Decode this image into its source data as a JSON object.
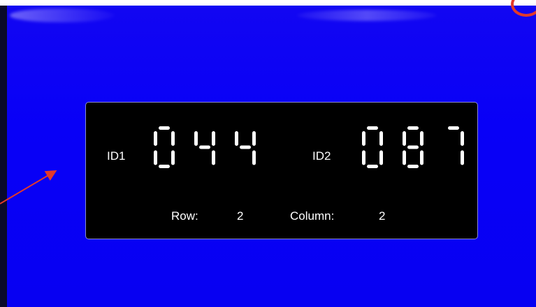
{
  "panel": {
    "id1_label": "ID1",
    "id1_value": "044",
    "id2_label": "ID2",
    "id2_value": "087",
    "row_label": "Row:",
    "row_value": "2",
    "column_label": "Column:",
    "column_value": "2"
  },
  "icons": {
    "annotation_arrow": "arrow-icon",
    "annotation_circle": "circle-mark-icon"
  },
  "colors": {
    "display_background": "#0800f7",
    "panel_background": "#000000",
    "segment_color": "#ffffff",
    "annotation_color": "#e23a2a"
  }
}
